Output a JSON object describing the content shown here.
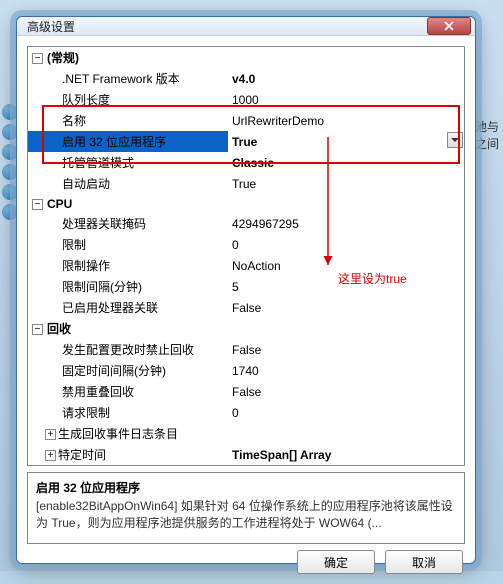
{
  "window": {
    "title": "高级设置"
  },
  "side_hint": {
    "line1": "序池与",
    "line2": "序之间"
  },
  "categories": [
    {
      "label": "(常规)",
      "expanded": true,
      "props": [
        {
          "name": ".NET Framework 版本",
          "value": "v4.0",
          "bold": true
        },
        {
          "name": "队列长度",
          "value": "1000"
        },
        {
          "name": "名称",
          "value": "UrlRewriterDemo"
        },
        {
          "name": "启用 32 位应用程序",
          "value": "True",
          "bold": true,
          "selected": true
        },
        {
          "name": "托管管道模式",
          "value": "Classic",
          "bold": true
        },
        {
          "name": "自动启动",
          "value": "True"
        }
      ]
    },
    {
      "label": "CPU",
      "expanded": true,
      "props": [
        {
          "name": "处理器关联掩码",
          "value": "4294967295"
        },
        {
          "name": "限制",
          "value": "0"
        },
        {
          "name": "限制操作",
          "value": "NoAction"
        },
        {
          "name": "限制间隔(分钟)",
          "value": "5"
        },
        {
          "name": "已启用处理器关联",
          "value": "False"
        }
      ]
    },
    {
      "label": "回收",
      "expanded": true,
      "props": [
        {
          "name": "发生配置更改时禁止回收",
          "value": "False"
        },
        {
          "name": "固定时间间隔(分钟)",
          "value": "1740"
        },
        {
          "name": "禁用重叠回收",
          "value": "False"
        },
        {
          "name": "请求限制",
          "value": "0"
        },
        {
          "name": "生成回收事件日志条目",
          "value": "",
          "expandable": true
        },
        {
          "name": "特定时间",
          "value": "TimeSpan[] Array",
          "bold": true,
          "expandable": true
        }
      ]
    }
  ],
  "description": {
    "title": "启用 32 位应用程序",
    "body": "[enable32BitAppOnWin64] 如果针对 64 位操作系统上的应用程序池将该属性设为 True，则为应用程序池提供服务的工作进程将处于 WOW64 (..."
  },
  "buttons": {
    "ok": "确定",
    "cancel": "取消"
  },
  "annotation": "这里设为true"
}
